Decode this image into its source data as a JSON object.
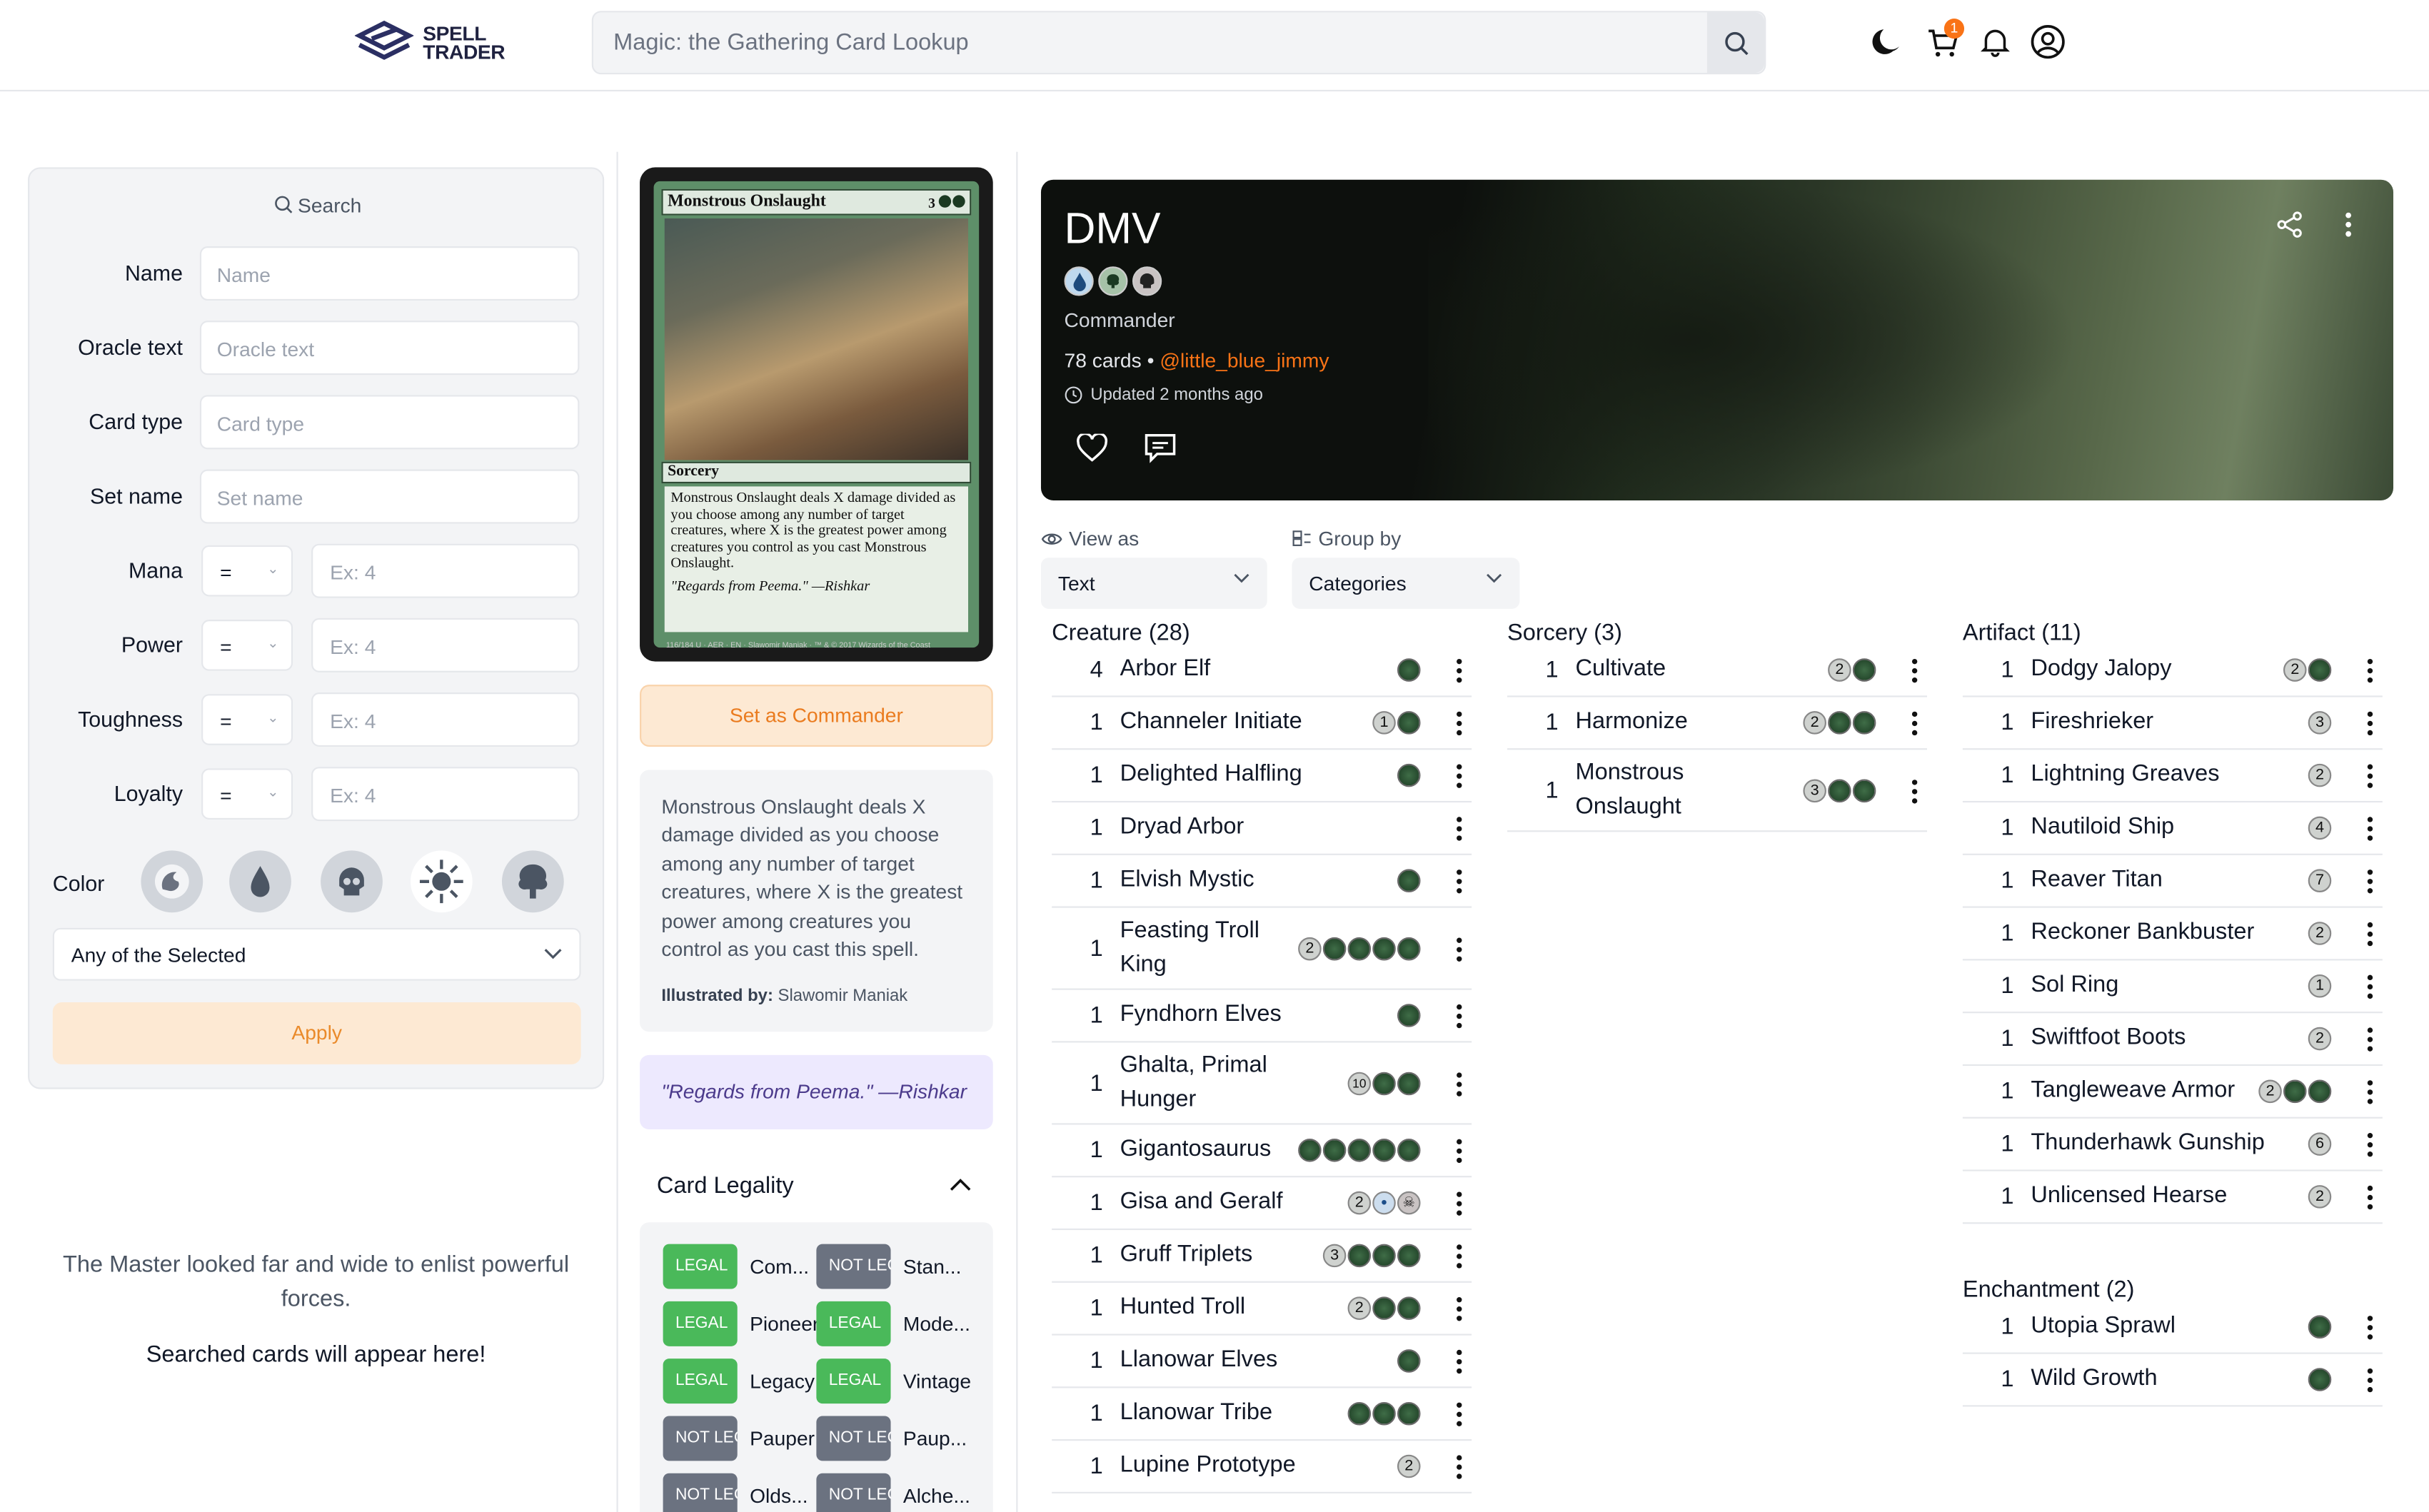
{
  "header": {
    "logo_line1": "SPELL",
    "logo_line2": "TRADER",
    "search_placeholder": "Magic: the Gathering Card Lookup",
    "cart_count": "1"
  },
  "filter": {
    "title": "Search",
    "name_label": "Name",
    "name_placeholder": "Name",
    "oracle_label": "Oracle text",
    "oracle_placeholder": "Oracle text",
    "type_label": "Card type",
    "type_placeholder": "Card type",
    "set_label": "Set name",
    "set_placeholder": "Set name",
    "mana_label": "Mana",
    "power_label": "Power",
    "toughness_label": "Toughness",
    "loyalty_label": "Loyalty",
    "op": "=",
    "num_placeholder": "Ex: 4",
    "color_label": "Color",
    "color_icons": [
      "red-mana-icon",
      "blue-mana-icon",
      "black-mana-icon",
      "white-mana-icon",
      "green-mana-icon"
    ],
    "match_mode": "Any of the Selected",
    "apply": "Apply",
    "empty_line1": "The Master looked far and wide to enlist powerful forces.",
    "empty_line2": "Searched cards will appear here!"
  },
  "card": {
    "name": "Monstrous Onslaught",
    "cost": "3",
    "type": "Sorcery",
    "rules": "Monstrous Onslaught deals X damage divided as you choose among any number of target creatures, where X is the greatest power among creatures you control as you cast Monstrous Onslaught.",
    "flavor": "\"Regards from Peema.\" —Rishkar",
    "footer": "116/184 U · AER · EN · Slawomir Maniak · ™ & © 2017 Wizards of the Coast"
  },
  "details": {
    "set_commander": "Set as Commander",
    "oracle": "Monstrous Onslaught deals X damage divided as you choose among any number of target creatures, where X is the greatest power among creatures you control as you cast this spell.",
    "illustrated_label": "Illustrated by:",
    "illustrator": "Slawomir Maniak",
    "flavor": "\"Regards from Peema.\" —Rishkar",
    "legality_title": "Card Legality",
    "legality": [
      {
        "status": "LEGAL",
        "format": "Com..."
      },
      {
        "status": "NOT LEGAL",
        "format": "Stan..."
      },
      {
        "status": "LEGAL",
        "format": "Pioneer"
      },
      {
        "status": "LEGAL",
        "format": "Mode..."
      },
      {
        "status": "LEGAL",
        "format": "Legacy"
      },
      {
        "status": "LEGAL",
        "format": "Vintage"
      },
      {
        "status": "NOT LEGAL",
        "format": "Pauper"
      },
      {
        "status": "NOT LEGAL",
        "format": "Paup..."
      },
      {
        "status": "NOT LEGAL",
        "format": "Olds..."
      },
      {
        "status": "NOT LEGAL",
        "format": "Alche..."
      }
    ]
  },
  "deck": {
    "title": "DMV",
    "format": "Commander",
    "count": "78 cards",
    "sep": "•",
    "owner": "@little_blue_jimmy",
    "updated": "Updated 2 months ago",
    "colors": [
      "blue-mana-icon",
      "green-mana-icon",
      "black-mana-icon"
    ]
  },
  "controls": {
    "view_label": "View as",
    "view_value": "Text",
    "group_label": "Group by",
    "group_value": "Categories"
  },
  "categories": [
    {
      "title": "Creature (28)",
      "cards": [
        {
          "qty": "4",
          "name": "Arbor Elf",
          "cost": [
            "g"
          ]
        },
        {
          "qty": "1",
          "name": "Channeler Initiate",
          "cost": [
            "1",
            "g"
          ]
        },
        {
          "qty": "1",
          "name": "Delighted Halfling",
          "cost": [
            "g"
          ]
        },
        {
          "qty": "1",
          "name": "Dryad Arbor",
          "cost": []
        },
        {
          "qty": "1",
          "name": "Elvish Mystic",
          "cost": [
            "g"
          ]
        },
        {
          "qty": "1",
          "name": "Feasting Troll King",
          "cost": [
            "2",
            "g",
            "g",
            "g",
            "g"
          ]
        },
        {
          "qty": "1",
          "name": "Fyndhorn Elves",
          "cost": [
            "g"
          ]
        },
        {
          "qty": "1",
          "name": "Ghalta, Primal Hunger",
          "cost": [
            "10",
            "g",
            "g"
          ]
        },
        {
          "qty": "1",
          "name": "Gigantosaurus",
          "cost": [
            "g",
            "g",
            "g",
            "g",
            "g"
          ]
        },
        {
          "qty": "1",
          "name": "Gisa and Geralf",
          "cost": [
            "2",
            "u",
            "b"
          ]
        },
        {
          "qty": "1",
          "name": "Gruff Triplets",
          "cost": [
            "3",
            "g",
            "g",
            "g"
          ]
        },
        {
          "qty": "1",
          "name": "Hunted Troll",
          "cost": [
            "2",
            "g",
            "g"
          ]
        },
        {
          "qty": "1",
          "name": "Llanowar Elves",
          "cost": [
            "g"
          ]
        },
        {
          "qty": "1",
          "name": "Llanowar Tribe",
          "cost": [
            "g",
            "g",
            "g"
          ]
        },
        {
          "qty": "1",
          "name": "Lupine Prototype",
          "cost": [
            "2"
          ]
        }
      ]
    },
    {
      "title": "Sorcery (3)",
      "cards": [
        {
          "qty": "1",
          "name": "Cultivate",
          "cost": [
            "2",
            "g"
          ]
        },
        {
          "qty": "1",
          "name": "Harmonize",
          "cost": [
            "2",
            "g",
            "g"
          ]
        },
        {
          "qty": "1",
          "name": "Monstrous Onslaught",
          "cost": [
            "3",
            "g",
            "g"
          ]
        }
      ]
    },
    {
      "title": "Artifact (11)",
      "cards": [
        {
          "qty": "1",
          "name": "Dodgy Jalopy",
          "cost": [
            "2",
            "g"
          ]
        },
        {
          "qty": "1",
          "name": "Fireshrieker",
          "cost": [
            "3"
          ]
        },
        {
          "qty": "1",
          "name": "Lightning Greaves",
          "cost": [
            "2"
          ]
        },
        {
          "qty": "1",
          "name": "Nautiloid Ship",
          "cost": [
            "4"
          ]
        },
        {
          "qty": "1",
          "name": "Reaver Titan",
          "cost": [
            "7"
          ]
        },
        {
          "qty": "1",
          "name": "Reckoner Bankbuster",
          "cost": [
            "2"
          ]
        },
        {
          "qty": "1",
          "name": "Sol Ring",
          "cost": [
            "1"
          ]
        },
        {
          "qty": "1",
          "name": "Swiftfoot Boots",
          "cost": [
            "2"
          ]
        },
        {
          "qty": "1",
          "name": "Tangleweave Armor",
          "cost": [
            "2",
            "g",
            "g"
          ]
        },
        {
          "qty": "1",
          "name": "Thunderhawk Gunship",
          "cost": [
            "6"
          ]
        },
        {
          "qty": "1",
          "name": "Unlicensed Hearse",
          "cost": [
            "2"
          ]
        }
      ]
    },
    {
      "title": "Enchantment (2)",
      "cards": [
        {
          "qty": "1",
          "name": "Utopia Sprawl",
          "cost": [
            "g"
          ]
        },
        {
          "qty": "1",
          "name": "Wild Growth",
          "cost": [
            "g"
          ]
        }
      ]
    }
  ]
}
